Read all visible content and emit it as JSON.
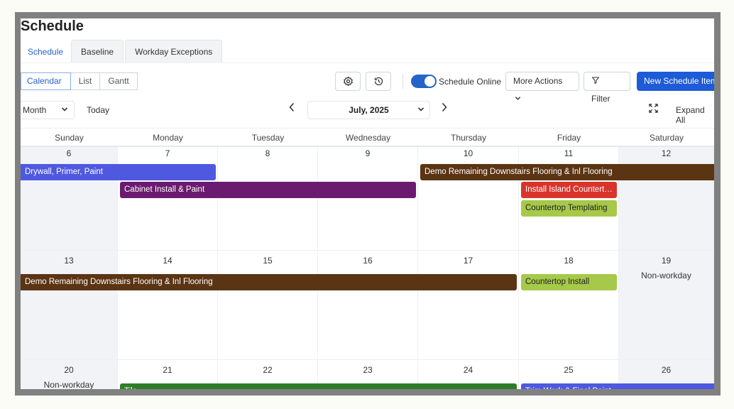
{
  "page_title": "Schedule",
  "tabs": [
    {
      "label": "Schedule",
      "active": true
    },
    {
      "label": "Baseline",
      "active": false
    },
    {
      "label": "Workday Exceptions",
      "active": false
    }
  ],
  "views": [
    {
      "label": "Calendar",
      "active": true
    },
    {
      "label": "List",
      "active": false
    },
    {
      "label": "Gantt",
      "active": false
    }
  ],
  "toolbar": {
    "settings_icon": "gear-icon",
    "history_icon": "history-icon",
    "schedule_online_label": "Schedule Online",
    "schedule_online_on": true,
    "more_actions_label": "More Actions",
    "filter_label": "Filter",
    "new_item_label": "New Schedule Item",
    "accent_color": "#1e5bd6"
  },
  "nav": {
    "period": "Month",
    "today_label": "Today",
    "current_month": "July, 2025",
    "expand_all_label": "Expand All"
  },
  "calendar": {
    "days_of_week": [
      "Sunday",
      "Monday",
      "Tuesday",
      "Wednesday",
      "Thursday",
      "Friday",
      "Saturday"
    ],
    "non_workday_label": "Non-workday",
    "weeks": [
      {
        "days": [
          "6",
          "7",
          "8",
          "9",
          "10",
          "11",
          "12"
        ],
        "nonwork": [
          0,
          6
        ],
        "show_nw_label": [],
        "events": [
          {
            "title": "Drywall, Primer, Paint",
            "color": "#4f59e0",
            "start": 0,
            "end": 1,
            "lane": 0,
            "dark": false
          },
          {
            "title": "Demo Remaining Downstairs Flooring & Inl Flooring",
            "color": "#5b3413",
            "start": 4,
            "end": 6,
            "lane": 0,
            "dark": false
          },
          {
            "title": "Cabinet Install & Paint",
            "color": "#6a1b6f",
            "start": 1,
            "end": 3,
            "lane": 1,
            "dark": false
          },
          {
            "title": "Install Island Countertops",
            "color": "#d8342b",
            "start": 5,
            "end": 5,
            "lane": 1,
            "dark": false
          },
          {
            "title": "Countertop Templating",
            "color": "#a6c94a",
            "start": 5,
            "end": 5,
            "lane": 2,
            "dark": true
          }
        ]
      },
      {
        "days": [
          "13",
          "14",
          "15",
          "16",
          "17",
          "18",
          "19"
        ],
        "nonwork": [
          0,
          6
        ],
        "show_nw_label": [
          6
        ],
        "events": [
          {
            "title": "Demo Remaining Downstairs Flooring & Inl Flooring",
            "color": "#5b3413",
            "start": 0,
            "end": 4,
            "lane": 0,
            "dark": false
          },
          {
            "title": "Countertop Install",
            "color": "#a6c94a",
            "start": 5,
            "end": 5,
            "lane": 0,
            "dark": true
          }
        ]
      },
      {
        "days": [
          "20",
          "21",
          "22",
          "23",
          "24",
          "25",
          "26"
        ],
        "nonwork": [
          0,
          6
        ],
        "show_nw_label": [
          0
        ],
        "events": [
          {
            "title": "Tile",
            "color": "#2f7d2a",
            "start": 1,
            "end": 4,
            "lane": 0,
            "dark": false
          },
          {
            "title": "Trim Work & Final Paint",
            "color": "#4f59e0",
            "start": 5,
            "end": 6,
            "lane": 0,
            "dark": false
          }
        ]
      }
    ]
  }
}
